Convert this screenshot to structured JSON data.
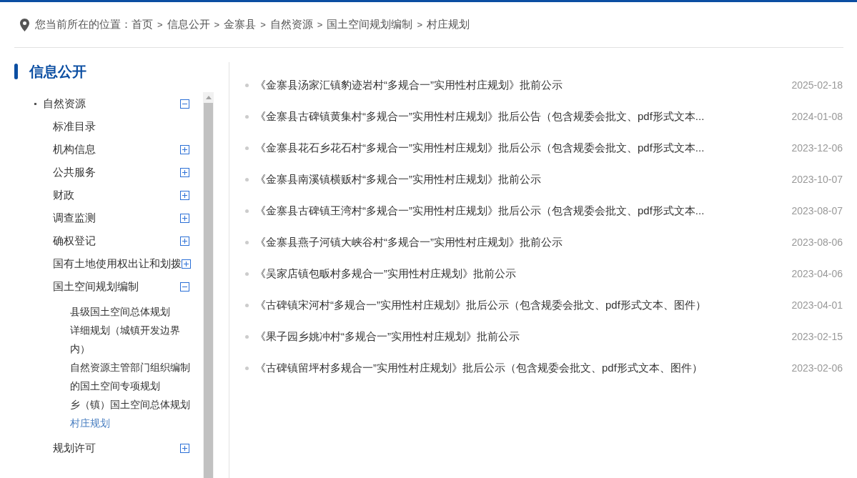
{
  "breadcrumb": {
    "label": "您当前所在的位置：",
    "items": [
      {
        "kind": "link",
        "text": "首页"
      },
      {
        "kind": "separator",
        "text": ">"
      },
      {
        "kind": "link",
        "text": "信息公开"
      },
      {
        "kind": "separator",
        "text": ">"
      },
      {
        "kind": "link",
        "text": "金寨县"
      },
      {
        "kind": "separator",
        "text": ">"
      },
      {
        "kind": "link",
        "text": "自然资源"
      },
      {
        "kind": "separator",
        "text": ">"
      },
      {
        "kind": "link",
        "text": "国土空间规划编制"
      },
      {
        "kind": "separator",
        "text": ">"
      },
      {
        "kind": "link",
        "text": "村庄规划"
      }
    ]
  },
  "sidebar": {
    "title": "信息公开",
    "tree": [
      {
        "label": "自然资源",
        "kind": "folder",
        "expanded": true,
        "children": [
          {
            "label": "标准目录",
            "kind": "leaf"
          },
          {
            "label": "机构信息",
            "kind": "folder",
            "expanded": false
          },
          {
            "label": "公共服务",
            "kind": "folder",
            "expanded": false
          },
          {
            "label": "财政",
            "kind": "folder",
            "expanded": false
          },
          {
            "label": "调查监测",
            "kind": "folder",
            "expanded": false
          },
          {
            "label": "确权登记",
            "kind": "folder",
            "expanded": false
          },
          {
            "label": "国有土地使用权出让和划拨",
            "kind": "folder",
            "expanded": false
          },
          {
            "label": "国土空间规划编制",
            "kind": "folder",
            "expanded": true,
            "children": [
              {
                "label": "县级国土空间总体规划",
                "selected": false
              },
              {
                "label": "详细规划（城镇开发边界内）",
                "selected": false
              },
              {
                "label": "自然资源主管部门组织编制的国土空间专项规划",
                "selected": false
              },
              {
                "label": "乡（镇）国土空间总体规划",
                "selected": false
              },
              {
                "label": "村庄规划",
                "selected": true
              }
            ]
          },
          {
            "label": "规划许可",
            "kind": "folder",
            "expanded": false
          }
        ]
      }
    ]
  },
  "articles": [
    {
      "title": "《金寨县汤家汇镇豹迹岩村“多规合一”实用性村庄规划》批前公示",
      "date": "2025-02-18"
    },
    {
      "title": "《金寨县古碑镇黄集村“多规合一”实用性村庄规划》批后公告（包含规委会批文、pdf形式文本...",
      "date": "2024-01-08"
    },
    {
      "title": "《金寨县花石乡花石村“多规合一”实用性村庄规划》批后公示（包含规委会批文、pdf形式文本...",
      "date": "2023-12-06"
    },
    {
      "title": "《金寨县南溪镇横贩村“多规合一”实用性村庄规划》批前公示",
      "date": "2023-10-07"
    },
    {
      "title": "《金寨县古碑镇王湾村“多规合一”实用性村庄规划》批后公示（包含规委会批文、pdf形式文本...",
      "date": "2023-08-07"
    },
    {
      "title": "《金寨县燕子河镇大峡谷村“多规合一”实用性村庄规划》批前公示",
      "date": "2023-08-06"
    },
    {
      "title": "《吴家店镇包畈村多规合一”实用性村庄规划》批前公示",
      "date": "2023-04-06"
    },
    {
      "title": "《古碑镇宋河村“多规合一”实用性村庄规划》批后公示（包含规委会批文、pdf形式文本、图件）",
      "date": "2023-04-01"
    },
    {
      "title": "《果子园乡姚冲村“多规合一”实用性村庄规划》批前公示",
      "date": "2023-02-15"
    },
    {
      "title": "《古碑镇留坪村多规合一”实用性村庄规划》批后公示（包含规委会批文、pdf形式文本、图件）",
      "date": "2023-02-06"
    }
  ]
}
